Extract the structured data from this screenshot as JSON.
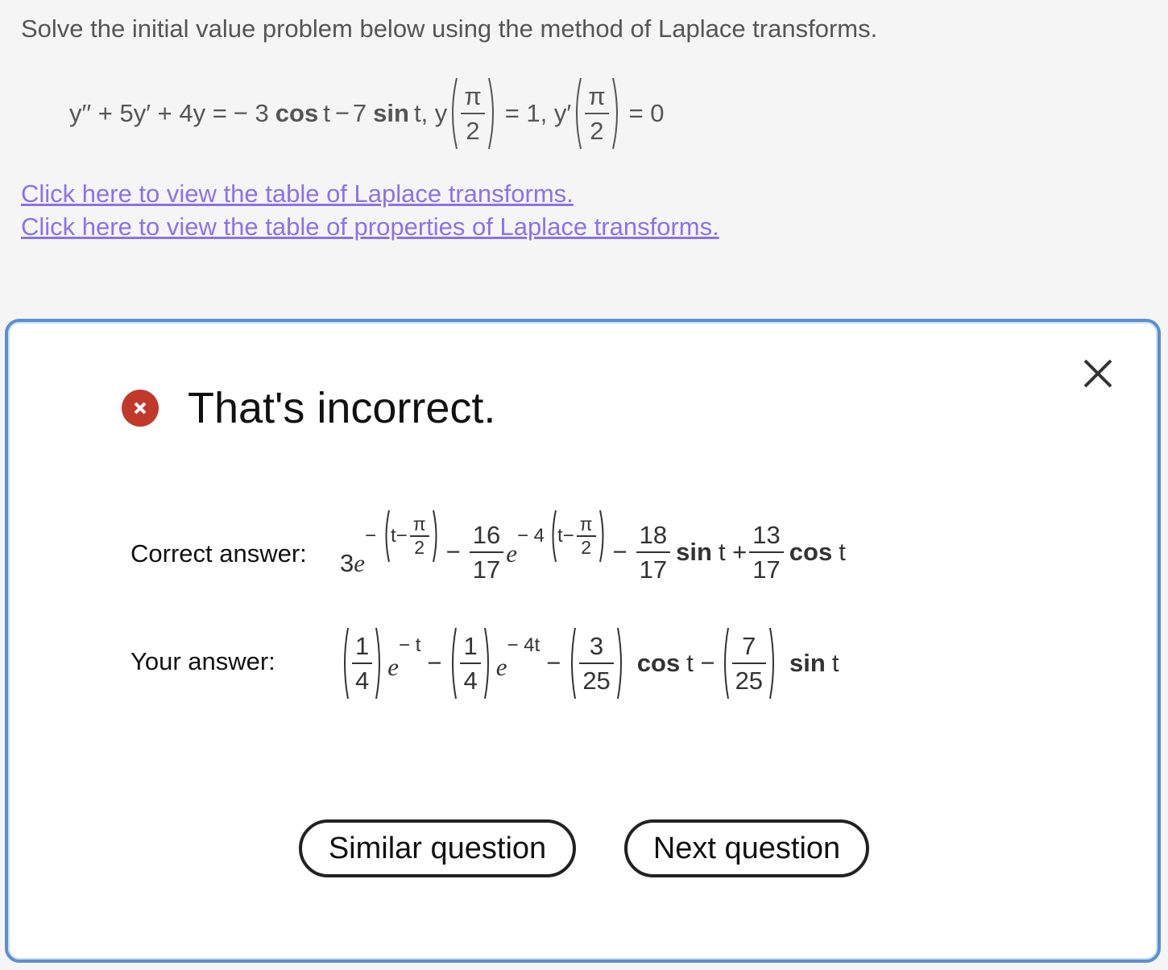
{
  "question": {
    "prompt": "Solve the initial value problem below using the method of Laplace transforms.",
    "equation": {
      "lhs": "y′′ + 5y′ + 4y =",
      "rhs_coef1": "− 3",
      "cos": "cos",
      "t1": "t",
      "minus": "−",
      "rhs_coef2": "7",
      "sin": "sin",
      "t2": "t, y",
      "pi": "π",
      "two": "2",
      "ic1": "= 1, y′",
      "ic2": "= 0"
    },
    "links": [
      "Click here to view the table of Laplace transforms.",
      "Click here to view the table of properties of Laplace transforms."
    ]
  },
  "feedback": {
    "status": "That's incorrect.",
    "correct_label": "Correct answer:",
    "your_label": "Your answer:",
    "correct": {
      "coef": "3",
      "e": "e",
      "exp1_sign": "−",
      "t": "t",
      "minus": "−",
      "pi": "π",
      "two": "2",
      "f2_num": "16",
      "f2_den": "17",
      "exp2_coef": "− 4",
      "f3_num": "18",
      "f3_den": "17",
      "sin": "sin",
      "t_plus": "t +",
      "f4_num": "13",
      "f4_den": "17",
      "cos": "cos",
      "t_end": "t"
    },
    "yours": {
      "one": "1",
      "four": "4",
      "e": "e",
      "exp1": "− t",
      "minus": "−",
      "exp2": "− 4t",
      "three": "3",
      "twentyfive": "25",
      "cos": "cos",
      "t_minus": "t −",
      "seven": "7",
      "sin": "sin",
      "t_end": "t"
    }
  },
  "buttons": {
    "similar": "Similar question",
    "next": "Next question"
  },
  "colors": {
    "link": "#8c72e8",
    "dialog_border": "#5b8fd0",
    "error": "#c0392b"
  },
  "icons": {
    "close": "close-icon",
    "status": "error-x-icon"
  }
}
